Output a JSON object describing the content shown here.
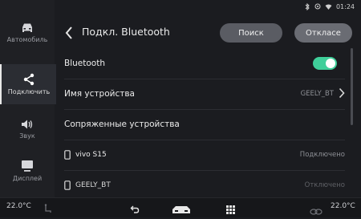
{
  "status_bar": {
    "time": "01:24"
  },
  "sidebar": {
    "items": [
      {
        "label": "Автомобиль",
        "icon": "car-icon",
        "active": false
      },
      {
        "label": "Подключить",
        "icon": "share-icon",
        "active": true
      },
      {
        "label": "Звук",
        "icon": "speaker-icon",
        "active": false
      },
      {
        "label": "Дисплей",
        "icon": "display-icon",
        "active": false
      },
      {
        "label": "Дисплей",
        "icon": "display-icon",
        "active": false
      }
    ]
  },
  "header": {
    "title": "Подкл. Bluetooth",
    "search_label": "Поиск",
    "cancel_label": "Отклаcе"
  },
  "settings": {
    "bluetooth_label": "Bluetooth",
    "bluetooth_enabled": true,
    "device_name_label": "Имя устройства",
    "device_name_value": "GEELY_BT",
    "paired_header": "Сопряженные устройства"
  },
  "devices": [
    {
      "name": "vivo S15",
      "status": "Подключено"
    },
    {
      "name": "GEELY_BT",
      "status": "Отключено"
    }
  ],
  "bottom_bar": {
    "temp_left": "22.0°C",
    "temp_right": "22.0°C"
  },
  "colors": {
    "accent_toggle": "#3fcf9a",
    "background": "#1b1c20"
  }
}
